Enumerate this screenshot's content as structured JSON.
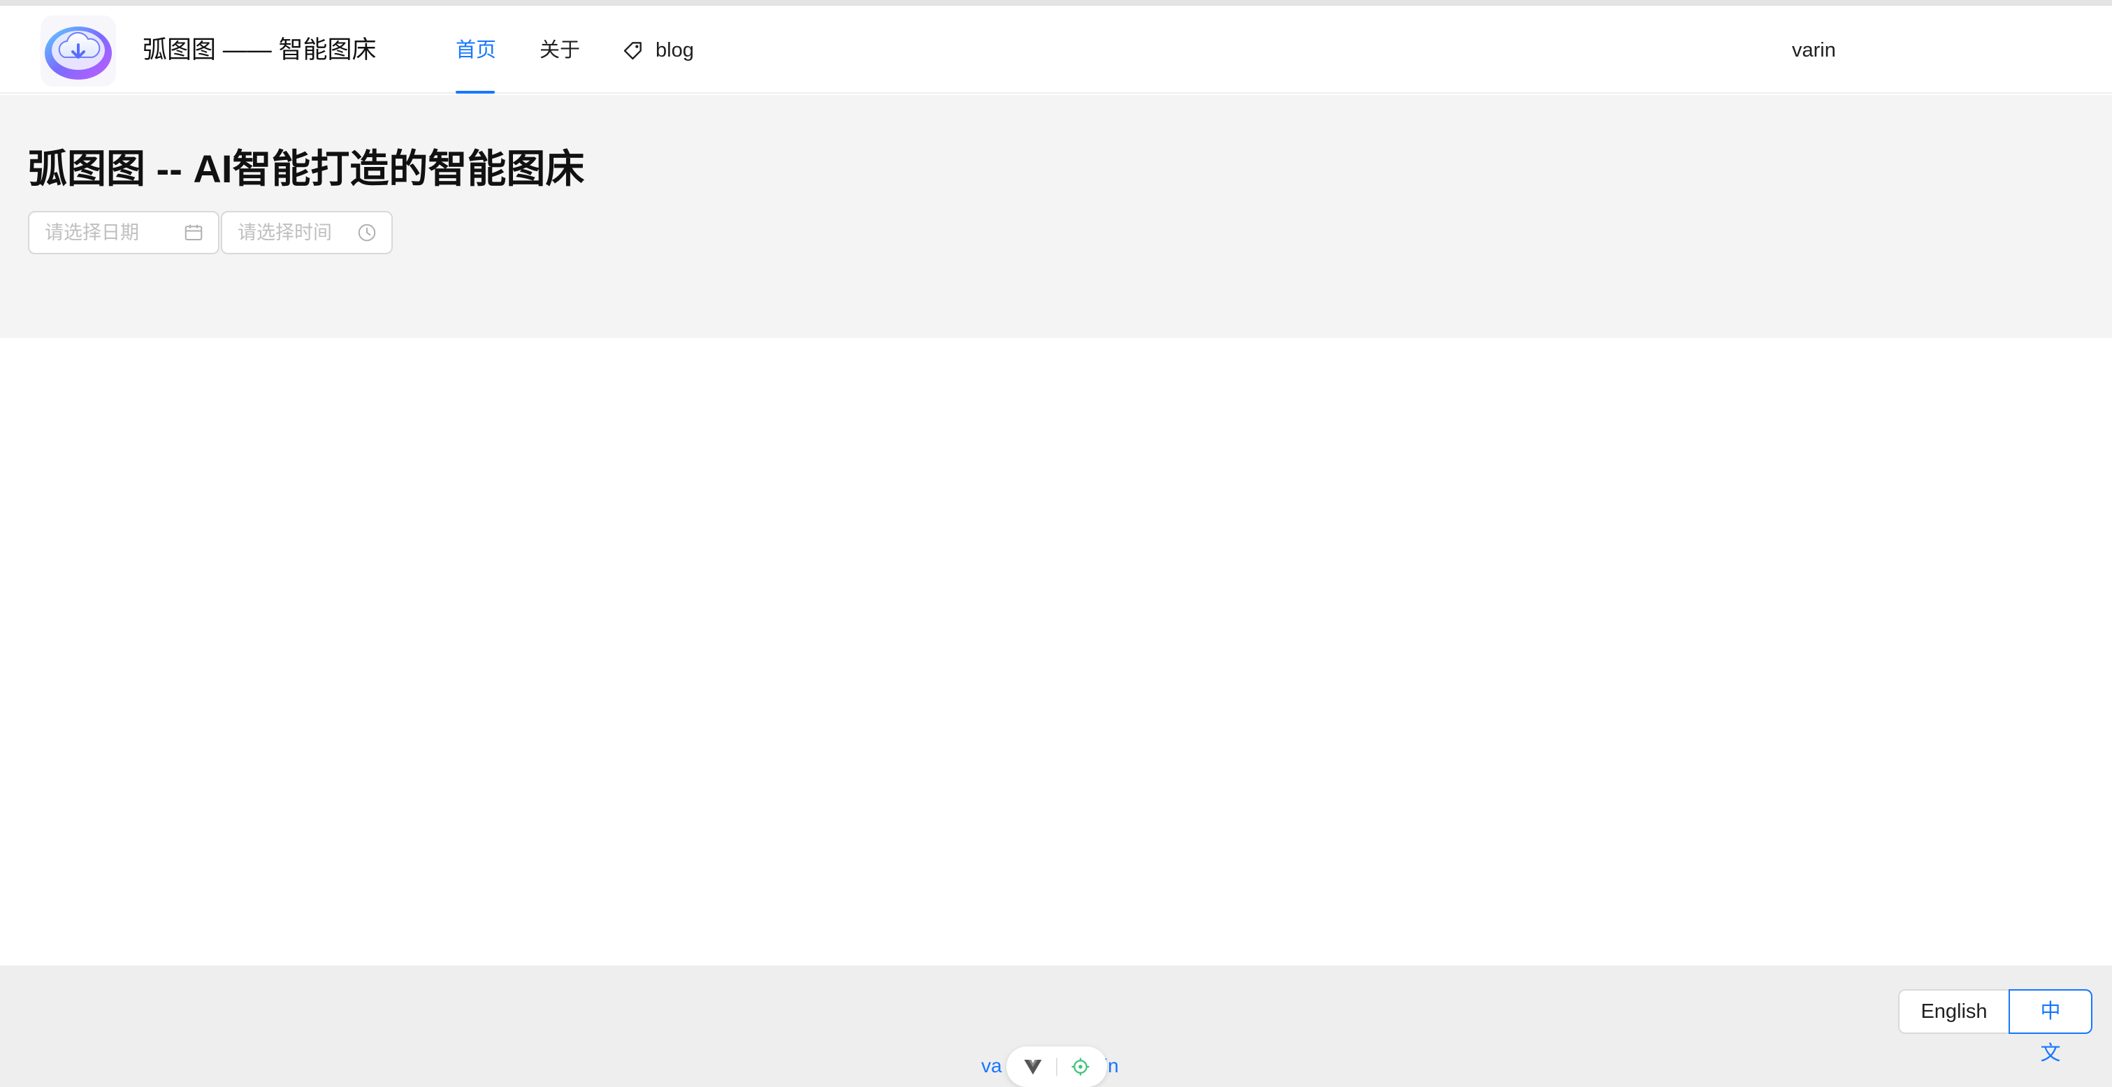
{
  "header": {
    "brand": "弧图图 —— 智能图床",
    "nav": {
      "home": "首页",
      "about": "关于",
      "blog": "blog"
    },
    "user": "varin",
    "logo_icon": "cloud-upload-logo",
    "blog_icon": "tag-icon",
    "accent_color": "#1677ff"
  },
  "hero": {
    "title": "弧图图 -- AI智能打造的智能图床",
    "date_placeholder": "请选择日期",
    "time_placeholder": "请选择时间",
    "date_icon": "calendar-icon",
    "time_icon": "clock-icon"
  },
  "footer": {
    "languages": {
      "english": "English",
      "chinese": "中文",
      "selected": "中文"
    },
    "link_left": "va",
    "link_right": "rin",
    "devtools_icons": [
      "vue-devtools-icon",
      "inspector-target-icon"
    ]
  }
}
